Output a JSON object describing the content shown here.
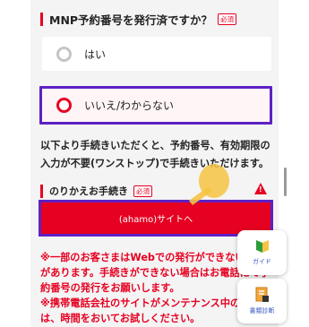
{
  "mnp_section": {
    "title": "MNP予約番号を発行済ですか？",
    "required_badge": "必須",
    "options": [
      {
        "label": "はい",
        "selected": false
      },
      {
        "label": "いいえ/わからない",
        "selected": true
      }
    ]
  },
  "info_text": "以下より手続きいただくと、予約番号、有効期限の入力が不要(ワンストップ)で手続きいただけます。",
  "switch_section": {
    "title": "のりかえお手続き",
    "required_badge": "必須",
    "cta_label": "(ahamo)サイトへ"
  },
  "notes": [
    "※一部のお客さまはWebでの発行ができない場合があります。手続きができない場合はお電話にて予約番号の発行をお願いします。",
    "※携帯電話会社のサイトがメンテナンス中の場合は、時間をおいてお試しください。"
  ],
  "floating_buttons": {
    "guide_label": "ガイド",
    "diagnosis_label": "書類診断"
  },
  "colors": {
    "accent_red": "#e60021",
    "highlight_purple": "#5d21c4",
    "panel_bg": "#f4f4f4"
  },
  "icons": [
    "guide-flag-icon",
    "document-icon",
    "warning-icon",
    "pointing-hand-icon"
  ]
}
